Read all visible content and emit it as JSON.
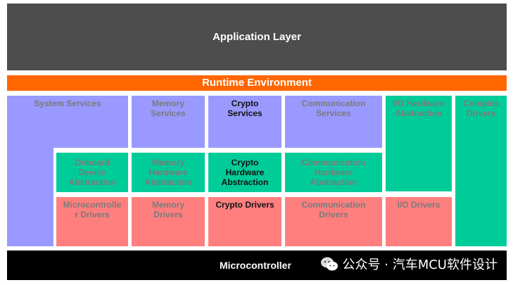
{
  "layers": {
    "application": "Application Layer",
    "runtime": "Runtime Environment",
    "microcontroller": "Microcontroller"
  },
  "blocks": {
    "system_services": "System Services",
    "memory_services": "Memory\nServices",
    "crypto_services": "Crypto\nServices",
    "communication_services": "Communication\nServices",
    "io_hardware_abstraction": "I/O Hardware\nAbstraction",
    "complex_drivers": "Complex\nDrivers",
    "onboard_device_abstraction": "Onboard\nDevice\nAbstraction",
    "memory_hardware_abstraction": "Memory\nHardware\nAbstraction",
    "crypto_hardware_abstraction": "Crypto\nHardware\nAbstraction",
    "communication_hardware_abstraction": "Communication\nHardware\nAbstraction",
    "microcontroller_drivers": "Microcontrolle\nr Drivers",
    "memory_drivers": "Memory\nDrivers",
    "crypto_drivers": "Crypto Drivers",
    "communication_drivers": "Communication\nDrivers",
    "io_drivers": "I/O Drivers"
  },
  "watermark": "公众号 · 汽车MCU软件设计",
  "colors": {
    "application": "#4d4d4d",
    "runtime": "#ff6600",
    "microcontroller": "#000000",
    "services": "#9999ff",
    "abstraction": "#00cc99",
    "drivers": "#ff7f7f"
  }
}
